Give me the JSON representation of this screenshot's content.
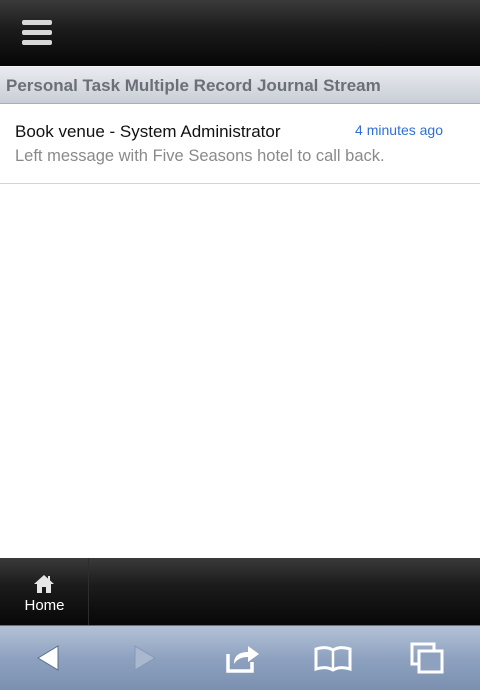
{
  "header": {
    "menu_icon": "hamburger-menu-icon"
  },
  "section": {
    "title": "Personal Task Multiple Record Journal Stream"
  },
  "items": [
    {
      "title": "Book venue - System Administrator",
      "time": "4 minutes ago",
      "body": "Left message with Five Seasons hotel to call back."
    }
  ],
  "bottom_nav": {
    "home_label": "Home",
    "home_icon": "home-icon"
  },
  "browser_toolbar": {
    "buttons": [
      "back-arrow-icon",
      "forward-arrow-icon",
      "share-icon",
      "bookmarks-icon",
      "tabs-icon"
    ]
  },
  "colors": {
    "accent_time": "#2f6fd6",
    "header_dark": "#1b1b1b",
    "toolbar_blue": "#8ea2c0"
  }
}
